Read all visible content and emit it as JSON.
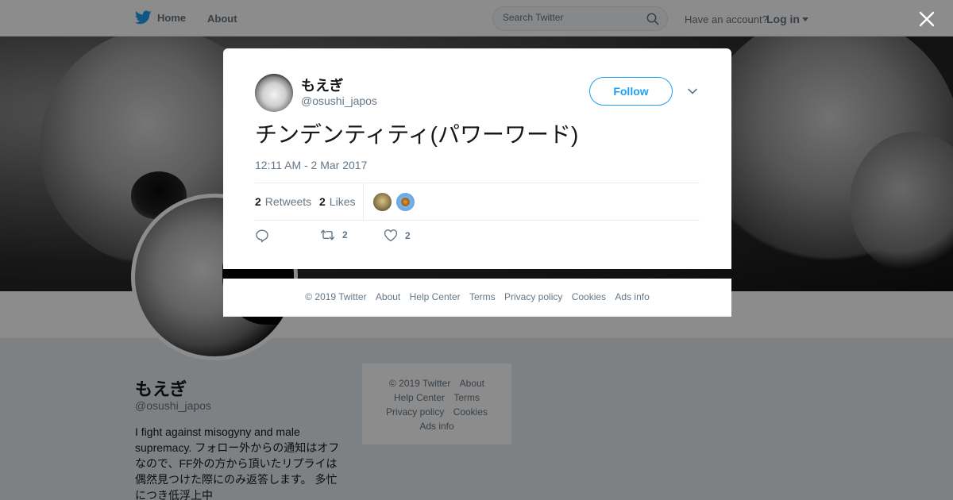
{
  "nav": {
    "home_label": "Home",
    "about_label": "About",
    "search_placeholder": "Search Twitter",
    "have_account": "Have an account?",
    "login_label": "Log in"
  },
  "profile": {
    "name": "もえぎ",
    "handle": "@osushi_japos",
    "bio": "I fight against misogyny and male supremacy. フォロー外からの通知はオフなので、FF外の方から頂いたリプライは偶然見つけた際にのみ返答します。 多忙につき低浮上中"
  },
  "sidebar_footer": {
    "copyright": "© 2019 Twitter",
    "about": "About",
    "help": "Help Center",
    "terms": "Terms",
    "privacy": "Privacy policy",
    "cookies": "Cookies",
    "ads": "Ads info"
  },
  "tweet": {
    "author_name": "もえぎ",
    "author_handle": "@osushi_japos",
    "follow_label": "Follow",
    "text": "チンデンティティ(パワーワード)",
    "timestamp": "12:11 AM - 2 Mar 2017",
    "retweets_count": "2",
    "retweets_label": "Retweets",
    "likes_count": "2",
    "likes_label": "Likes",
    "action_retweet_count": "2",
    "action_like_count": "2"
  },
  "modal_footer": {
    "copyright": "© 2019 Twitter",
    "about": "About",
    "help": "Help Center",
    "terms": "Terms",
    "privacy": "Privacy policy",
    "cookies": "Cookies",
    "ads": "Ads info"
  },
  "icons": {
    "brand": "twitter-bird-icon",
    "search": "search-icon",
    "close": "close-icon",
    "more": "chevron-down-icon",
    "reply": "reply-icon",
    "retweet": "retweet-icon",
    "like": "heart-icon"
  },
  "colors": {
    "brand_blue": "#1da1f2",
    "text_secondary": "#657786",
    "text_primary": "#14171a"
  }
}
